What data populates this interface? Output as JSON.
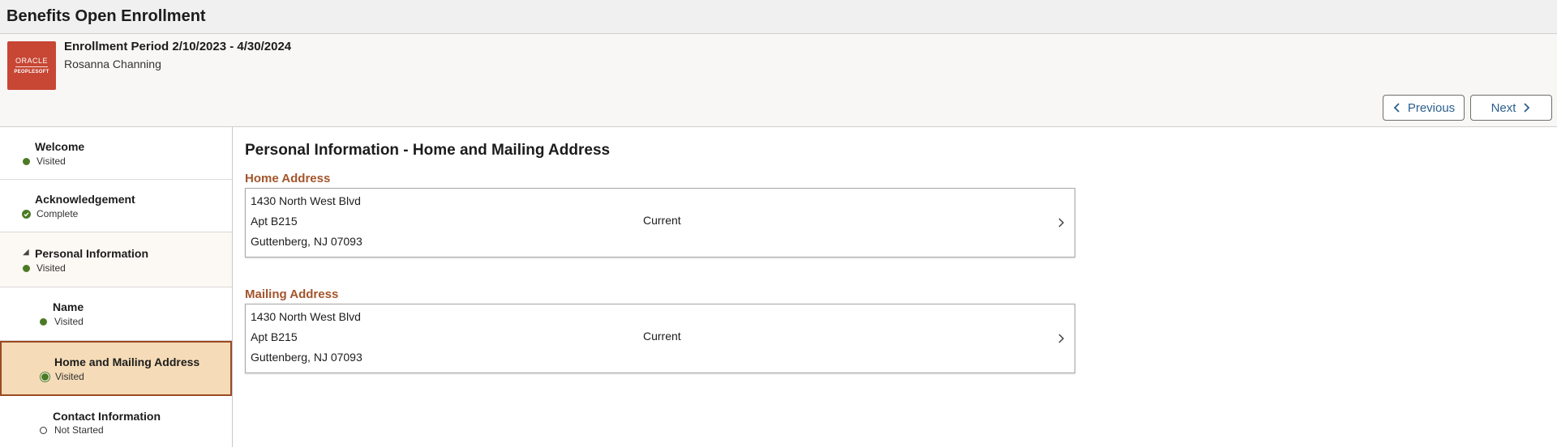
{
  "app": {
    "title": "Benefits Open Enrollment"
  },
  "banner": {
    "period": "Enrollment Period 2/10/2023 - 4/30/2024",
    "person": "Rosanna Channing",
    "logo_line1": "ORACLE",
    "logo_line2": "PEOPLESOFT"
  },
  "nav": {
    "previous_label": "Previous",
    "next_label": "Next"
  },
  "sidebar": {
    "items": [
      {
        "label": "Welcome",
        "status": "Visited"
      },
      {
        "label": "Acknowledgement",
        "status": "Complete"
      },
      {
        "label": "Personal Information",
        "status": "Visited"
      },
      {
        "label": "Name",
        "status": "Visited"
      },
      {
        "label": "Home and Mailing Address",
        "status": "Visited"
      },
      {
        "label": "Contact Information",
        "status": "Not Started"
      }
    ]
  },
  "main": {
    "title": "Personal Information - Home and Mailing Address",
    "home": {
      "heading": "Home Address",
      "line1": "1430 North West Blvd",
      "line2": "Apt B215",
      "line3": "Guttenberg, NJ 07093",
      "status": "Current"
    },
    "mailing": {
      "heading": "Mailing Address",
      "line1": "1430 North West Blvd",
      "line2": "Apt B215",
      "line3": "Guttenberg, NJ 07093",
      "status": "Current"
    }
  },
  "colors": {
    "accent_brown": "#a3552b",
    "selected_bg": "#f5dbb7",
    "status_green": "#4c7a24",
    "link_blue": "#2c5f8e",
    "logo_red": "#c74634"
  },
  "icons": {
    "previous": "chevron-left-icon",
    "next": "chevron-right-icon",
    "visited": "green-dot-icon",
    "complete": "check-circle-icon",
    "not_started": "empty-circle-icon",
    "expanded": "triangle-down-icon"
  }
}
